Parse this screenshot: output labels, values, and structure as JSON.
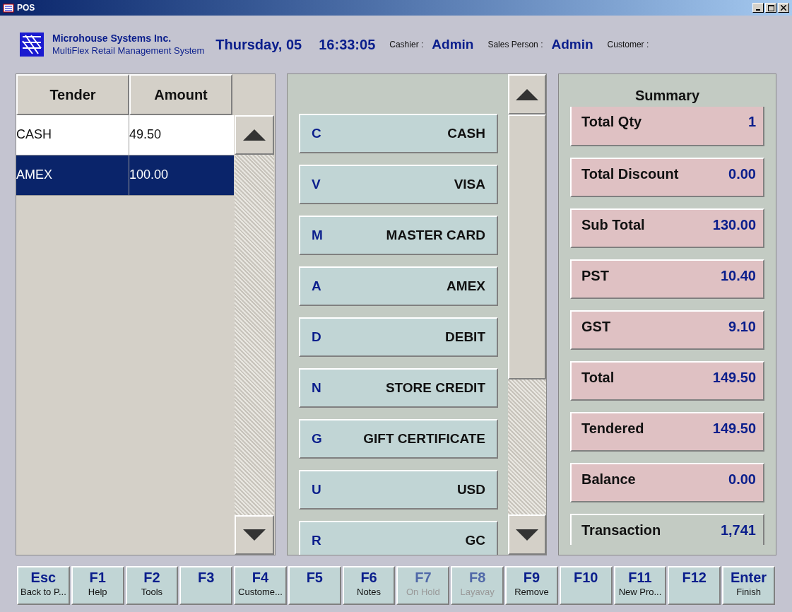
{
  "window": {
    "title": "POS"
  },
  "header": {
    "company": "Microhouse Systems Inc.",
    "product": "MultiFlex Retail Management System",
    "date": "Thursday, 05",
    "time": "16:33:05",
    "cashier_label": "Cashier :",
    "cashier": "Admin",
    "sales_person_label": "Sales Person :",
    "sales_person": "Admin",
    "customer_label": "Customer :"
  },
  "tender_table": {
    "columns": [
      "Tender",
      "Amount"
    ],
    "rows": [
      {
        "tender": "CASH",
        "amount": "49.50",
        "selected": false
      },
      {
        "tender": "AMEX",
        "amount": "100.00",
        "selected": true
      }
    ]
  },
  "tender_buttons": [
    {
      "key": "C",
      "label": "CASH"
    },
    {
      "key": "V",
      "label": "VISA"
    },
    {
      "key": "M",
      "label": "MASTER CARD"
    },
    {
      "key": "A",
      "label": "AMEX"
    },
    {
      "key": "D",
      "label": "DEBIT"
    },
    {
      "key": "N",
      "label": "STORE CREDIT"
    },
    {
      "key": "G",
      "label": "GIFT CERTIFICATE"
    },
    {
      "key": "U",
      "label": "USD"
    },
    {
      "key": "R",
      "label": "GC"
    }
  ],
  "summary": {
    "title": "Summary",
    "rows": [
      {
        "label": "Total Qty",
        "value": "1",
        "kind": "amount"
      },
      {
        "label": "Total Discount",
        "value": "0.00",
        "kind": "amount"
      },
      {
        "label": "Sub Total",
        "value": "130.00",
        "kind": "amount"
      },
      {
        "label": "PST",
        "value": "10.40",
        "kind": "amount"
      },
      {
        "label": "GST",
        "value": "9.10",
        "kind": "amount"
      },
      {
        "label": "Total",
        "value": "149.50",
        "kind": "amount"
      },
      {
        "label": "Tendered",
        "value": "149.50",
        "kind": "amount"
      },
      {
        "label": "Balance",
        "value": "0.00",
        "kind": "amount"
      },
      {
        "label": "Transaction",
        "value": "1,741",
        "kind": "info"
      }
    ]
  },
  "function_keys": [
    {
      "key": "Esc",
      "label": "Back to P...",
      "disabled": false
    },
    {
      "key": "F1",
      "label": "Help",
      "disabled": false
    },
    {
      "key": "F2",
      "label": "Tools",
      "disabled": false
    },
    {
      "key": "F3",
      "disabled": false
    },
    {
      "key": "F4",
      "label": "Custome...",
      "disabled": false
    },
    {
      "key": "F5",
      "disabled": false
    },
    {
      "key": "F6",
      "label": "Notes",
      "disabled": false
    },
    {
      "key": "F7",
      "label": "On Hold",
      "disabled": true
    },
    {
      "key": "F8",
      "label": "Layavay",
      "disabled": true
    },
    {
      "key": "F9",
      "label": "Remove",
      "disabled": false
    },
    {
      "key": "F10",
      "disabled": false
    },
    {
      "key": "F11",
      "label": "New Pro...",
      "disabled": false
    },
    {
      "key": "F12",
      "disabled": false
    },
    {
      "key": "Enter",
      "label": "Finish",
      "disabled": false
    }
  ]
}
